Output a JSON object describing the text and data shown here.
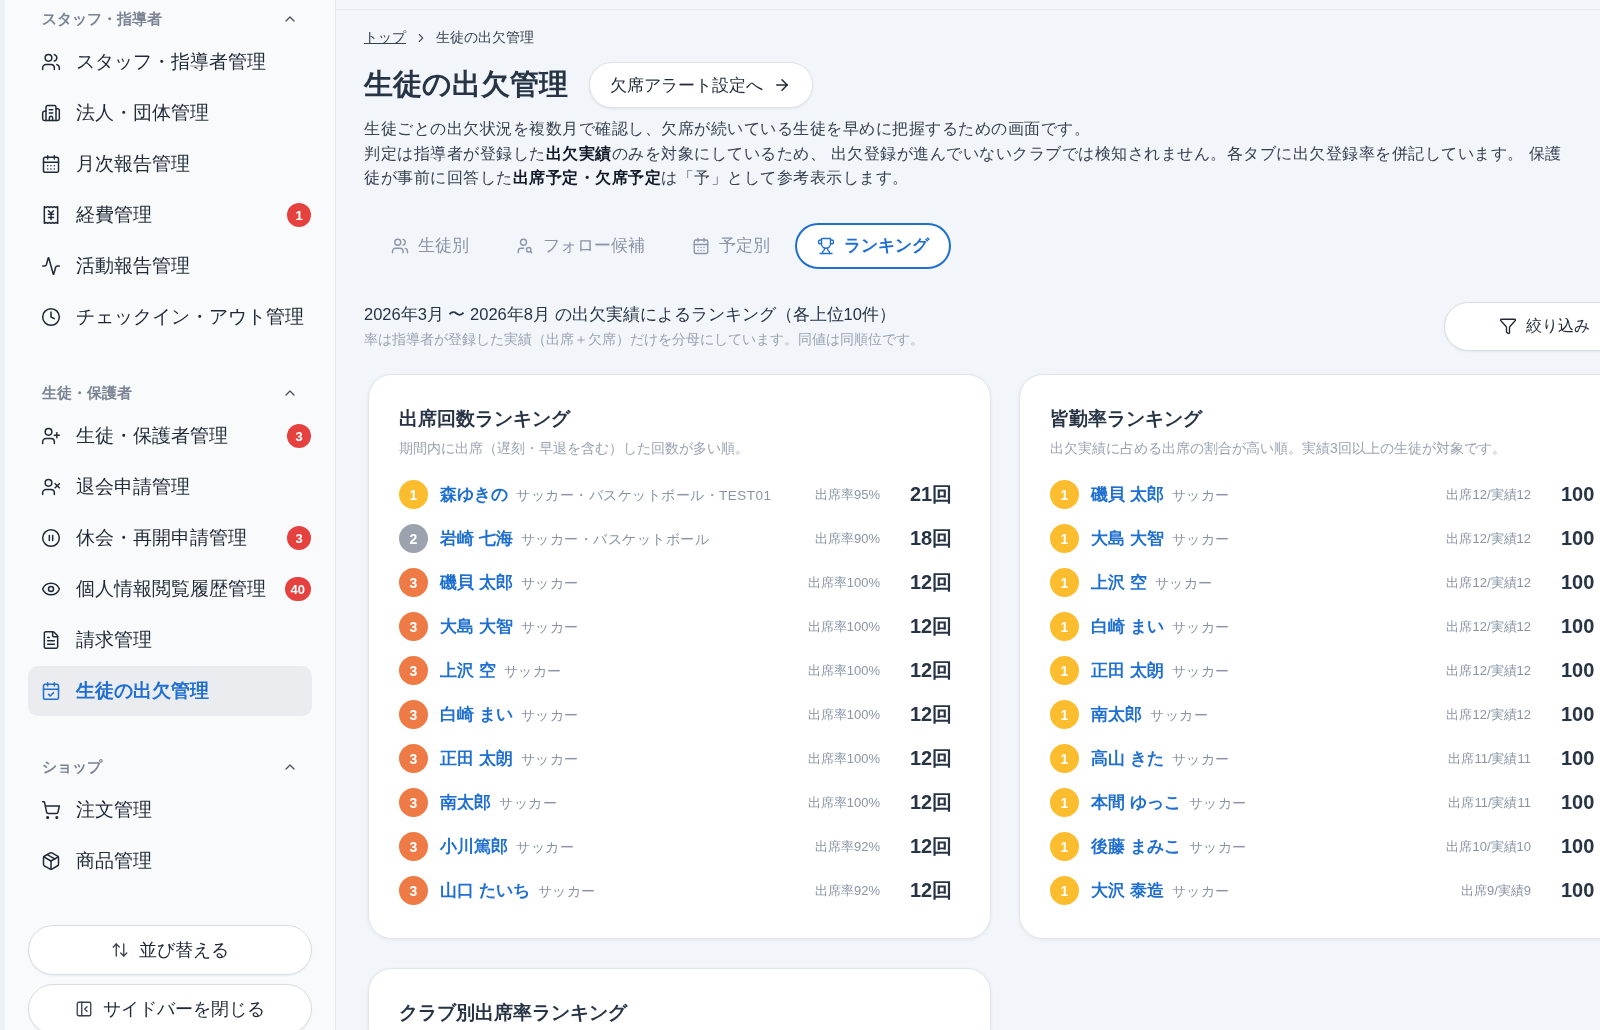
{
  "sidebar": {
    "sections": [
      {
        "title": "スタッフ・指導者",
        "expanded": true,
        "items": [
          {
            "label": "スタッフ・指導者管理",
            "selected": false
          },
          {
            "label": "法人・団体管理",
            "selected": false
          },
          {
            "label": "月次報告管理",
            "selected": false
          },
          {
            "label": "経費管理",
            "badge": "1",
            "selected": false
          },
          {
            "label": "活動報告管理",
            "selected": false
          },
          {
            "label": "チェックイン・アウト管理",
            "selected": false
          }
        ]
      },
      {
        "title": "生徒・保護者",
        "expanded": true,
        "items": [
          {
            "label": "生徒・保護者管理",
            "badge": "3",
            "selected": false
          },
          {
            "label": "退会申請管理",
            "selected": false
          },
          {
            "label": "休会・再開申請管理",
            "badge": "3",
            "selected": false
          },
          {
            "label": "個人情報閲覧履歴管理",
            "badge": "40",
            "selected": false
          },
          {
            "label": "請求管理",
            "selected": false
          },
          {
            "label": "生徒の出欠管理",
            "selected": true
          }
        ]
      },
      {
        "title": "ショップ",
        "expanded": true,
        "items": [
          {
            "label": "注文管理",
            "selected": false
          },
          {
            "label": "商品管理",
            "selected": false
          }
        ]
      }
    ],
    "buttons": [
      "並び替える",
      "サイドバーを閉じる"
    ]
  },
  "breadcrumb": [
    "トップ",
    "生徒の出欠管理"
  ],
  "page_title": "生徒の出欠管理",
  "alert_button": "欠席アラート設定へ",
  "description": [
    "生徒ごとの出欠状況を複数月で確認し、欠席が続いている生徒を早めに把握するための画面です。",
    "判定は指導者が登録した**出欠実績**のみを対象にしているため、 出欠登録が進んでいないクラブでは検知されません。各タブに出欠登録率を併記しています。 保護",
    "徒が事前に回答した**出席予定・欠席予定**は「予」として参考表示します。"
  ],
  "tabs": [
    {
      "label": "生徒別",
      "selected": false
    },
    {
      "label": "フォロー候補",
      "selected": false
    },
    {
      "label": "予定別",
      "selected": false
    },
    {
      "label": "ランキング",
      "selected": true
    }
  ],
  "range_title": "2026年3月 〜 2026年8月 の出欠実績によるランキング（各上位10件）",
  "range_note": "率は指導者が登録した実績（出席＋欠席）だけを分母にしています。同値は同順位です。",
  "filter_button": "絞り込み",
  "cards": [
    {
      "title": "出席回数ランキング",
      "description": "期間内に出席（遅刻・早退を含む）した回数が多い順。",
      "rows": [
        {
          "rank": "1",
          "color": "#fbbd2e",
          "name": "森ゆきの",
          "clubs": "サッカー・バスケットボール・TEST01",
          "rate": "出席率95%",
          "value": "21回"
        },
        {
          "rank": "2",
          "color": "#9ca3af",
          "name": "岩崎 七海",
          "clubs": "サッカー・バスケットボール",
          "rate": "出席率90%",
          "value": "18回"
        },
        {
          "rank": "3",
          "color": "#ee7b46",
          "name": "磯貝 太郎",
          "clubs": "サッカー",
          "rate": "出席率100%",
          "value": "12回"
        },
        {
          "rank": "3",
          "color": "#ee7b46",
          "name": "大島 大智",
          "clubs": "サッカー",
          "rate": "出席率100%",
          "value": "12回"
        },
        {
          "rank": "3",
          "color": "#ee7b46",
          "name": "上沢 空",
          "clubs": "サッカー",
          "rate": "出席率100%",
          "value": "12回"
        },
        {
          "rank": "3",
          "color": "#ee7b46",
          "name": "白崎 まい",
          "clubs": "サッカー",
          "rate": "出席率100%",
          "value": "12回"
        },
        {
          "rank": "3",
          "color": "#ee7b46",
          "name": "正田 太朗",
          "clubs": "サッカー",
          "rate": "出席率100%",
          "value": "12回"
        },
        {
          "rank": "3",
          "color": "#ee7b46",
          "name": "南太郎",
          "clubs": "サッカー",
          "rate": "出席率100%",
          "value": "12回"
        },
        {
          "rank": "3",
          "color": "#ee7b46",
          "name": "小川篤郎",
          "clubs": "サッカー",
          "rate": "出席率92%",
          "value": "12回"
        },
        {
          "rank": "3",
          "color": "#ee7b46",
          "name": "山口 たいち",
          "clubs": "サッカー",
          "rate": "出席率92%",
          "value": "12回"
        }
      ]
    },
    {
      "title": "皆勤率ランキング",
      "description": "出欠実績に占める出席の割合が高い順。実績3回以上の生徒が対象です。",
      "rows": [
        {
          "rank": "1",
          "color": "#fbbd2e",
          "name": "磯貝 太郎",
          "clubs": "サッカー",
          "rate": "出席12/実績12",
          "value": "100"
        },
        {
          "rank": "1",
          "color": "#fbbd2e",
          "name": "大島 大智",
          "clubs": "サッカー",
          "rate": "出席12/実績12",
          "value": "100"
        },
        {
          "rank": "1",
          "color": "#fbbd2e",
          "name": "上沢 空",
          "clubs": "サッカー",
          "rate": "出席12/実績12",
          "value": "100"
        },
        {
          "rank": "1",
          "color": "#fbbd2e",
          "name": "白崎 まい",
          "clubs": "サッカー",
          "rate": "出席12/実績12",
          "value": "100"
        },
        {
          "rank": "1",
          "color": "#fbbd2e",
          "name": "正田 太朗",
          "clubs": "サッカー",
          "rate": "出席12/実績12",
          "value": "100"
        },
        {
          "rank": "1",
          "color": "#fbbd2e",
          "name": "南太郎",
          "clubs": "サッカー",
          "rate": "出席12/実績12",
          "value": "100"
        },
        {
          "rank": "1",
          "color": "#fbbd2e",
          "name": "高山 きた",
          "clubs": "サッカー",
          "rate": "出席11/実績11",
          "value": "100"
        },
        {
          "rank": "1",
          "color": "#fbbd2e",
          "name": "本間 ゆっこ",
          "clubs": "サッカー",
          "rate": "出席11/実績11",
          "value": "100"
        },
        {
          "rank": "1",
          "color": "#fbbd2e",
          "name": "後藤 まみこ",
          "clubs": "サッカー",
          "rate": "出席10/実績10",
          "value": "100"
        },
        {
          "rank": "1",
          "color": "#fbbd2e",
          "name": "大沢 泰造",
          "clubs": "サッカー",
          "rate": "出席9/実績9",
          "value": "100"
        }
      ]
    },
    {
      "title": "クラブ別出席率ランキング"
    }
  ]
}
